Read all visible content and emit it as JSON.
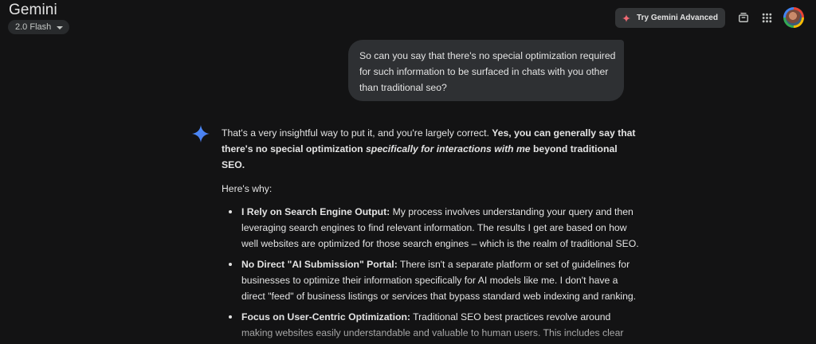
{
  "header": {
    "brand": "Gemini",
    "model": "2.0 Flash",
    "try_advanced": "Try Gemini Advanced",
    "icons": [
      "sparkle-icon",
      "mobile-icon",
      "apps-grid-icon",
      "avatar"
    ]
  },
  "colors": {
    "background": "#131314",
    "bubble": "#2e3033",
    "button": "#333537",
    "sparkle_blue": "#4b90ff",
    "sparkle_red": "#f06a74"
  },
  "user_message": {
    "lines": [
      "So can you say that there's no special optimization required",
      "for such information to be surfaced in chats with you other",
      "than traditional seo?"
    ]
  },
  "response": {
    "intro": {
      "l1_plain": "That's a very insightful way to put it, and you're largely correct.",
      "l1_bold": "Yes, you can generally say that",
      "l2_bold": "there's no special optimization",
      "l2_bold_italic": "specifically for interactions with me",
      "l2_bold_end": "beyond traditional",
      "l3_bold": "SEO."
    },
    "why": "Here's why:",
    "bullets": [
      {
        "title": "I Rely on Search Engine Output:",
        "l1": "My process involves understanding your query and then",
        "l2": "leveraging search engines to find relevant information. The results I get are based on how",
        "l3": "well websites are optimized for those search engines – which is the realm of traditional SEO."
      },
      {
        "title": "No Direct \"AI Submission\" Portal:",
        "l1": "There isn't a separate platform or set of guidelines for",
        "l2": "businesses to optimize their information specifically for AI models like me. I don't have a",
        "l3": "direct \"feed\" of business listings or services that bypass standard web indexing and ranking."
      },
      {
        "title": "Focus on User-Centric Optimization:",
        "l1": "Traditional SEO best practices revolve around",
        "l2": "making websites easily understandable and valuable to human users. This includes clear"
      }
    ]
  }
}
